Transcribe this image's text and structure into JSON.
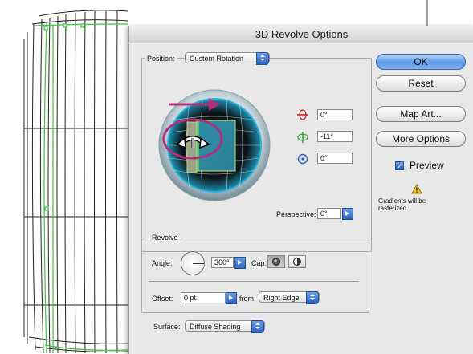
{
  "dialog": {
    "title": "3D Revolve Options",
    "position": {
      "label": "Position:",
      "preset": "Custom Rotation",
      "x_rotation": "0°",
      "y_rotation": "-11°",
      "z_rotation": "0°",
      "perspective_label": "Perspective:",
      "perspective_value": "0°"
    },
    "revolve": {
      "label": "Revolve",
      "angle_label": "Angle:",
      "angle_value": "360°",
      "cap_label": "Cap:",
      "offset_label": "Offset:",
      "offset_value": "0 pt",
      "from_label": "from",
      "from_value": "Right Edge"
    },
    "surface": {
      "label": "Surface:",
      "value": "Diffuse Shading"
    },
    "buttons": {
      "ok": "OK",
      "reset": "Reset",
      "map_art": "Map Art...",
      "more_options": "More Options"
    },
    "preview": {
      "label": "Preview",
      "checked": true
    },
    "warning": {
      "line1": "Gradients will be",
      "line2": "rasterized."
    }
  },
  "colors": {
    "cube_face": "#2f8fa8",
    "annotation": "#b0307a",
    "wireframe_green": "#3cc13c",
    "button_blue": "#5d98e6"
  },
  "icons": [
    "x-axis-rotation-icon",
    "y-axis-rotation-icon",
    "z-axis-rotation-icon",
    "warning-icon",
    "cap-on-icon",
    "cap-off-icon",
    "rotation-arrow-icon"
  ]
}
